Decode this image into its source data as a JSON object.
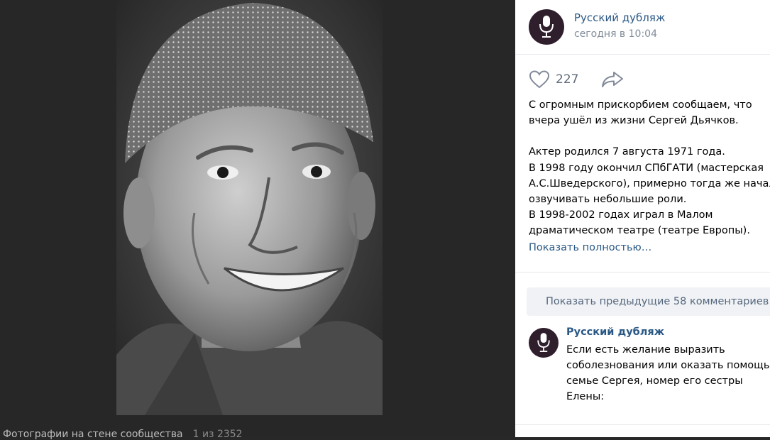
{
  "viewer": {
    "footer_label": "Фотографии на стене сообщества",
    "counter": "1 из 2352"
  },
  "post": {
    "author": "Русский дубляж",
    "time": "сегодня в 10:04",
    "likes": "227",
    "text_lines": [
      "С огромным прискорбием сообщаем, что",
      "вчера ушёл из жизни Сергей Дьячков.",
      "",
      "Актер родился 7 августа 1971 года.",
      "В 1998 году окончил СПбГАТИ (мастерская",
      "А.С.Шведерского), примерно тогда же начал",
      "озвучивать небольшие роли.",
      "В 1998-2002 годах играл в Малом",
      "драматическом театре (театре Европы)."
    ],
    "show_more": "Показать полностью…"
  },
  "comments": {
    "show_previous": "Показать предыдущие 58 комментариев",
    "items": [
      {
        "author": "Русский дубляж",
        "text_lines": [
          "Если есть желание выразить",
          "соболезнования или оказать помощь",
          "семье Сергея, номер его сестры",
          "Елены:"
        ]
      }
    ]
  },
  "icons": {
    "avatar": "microphone-icon",
    "like": "heart-icon",
    "share": "share-arrow-icon"
  },
  "colors": {
    "link": "#2a5885",
    "avatar_bg": "#2f1e2c",
    "viewer_bg": "#272727"
  }
}
